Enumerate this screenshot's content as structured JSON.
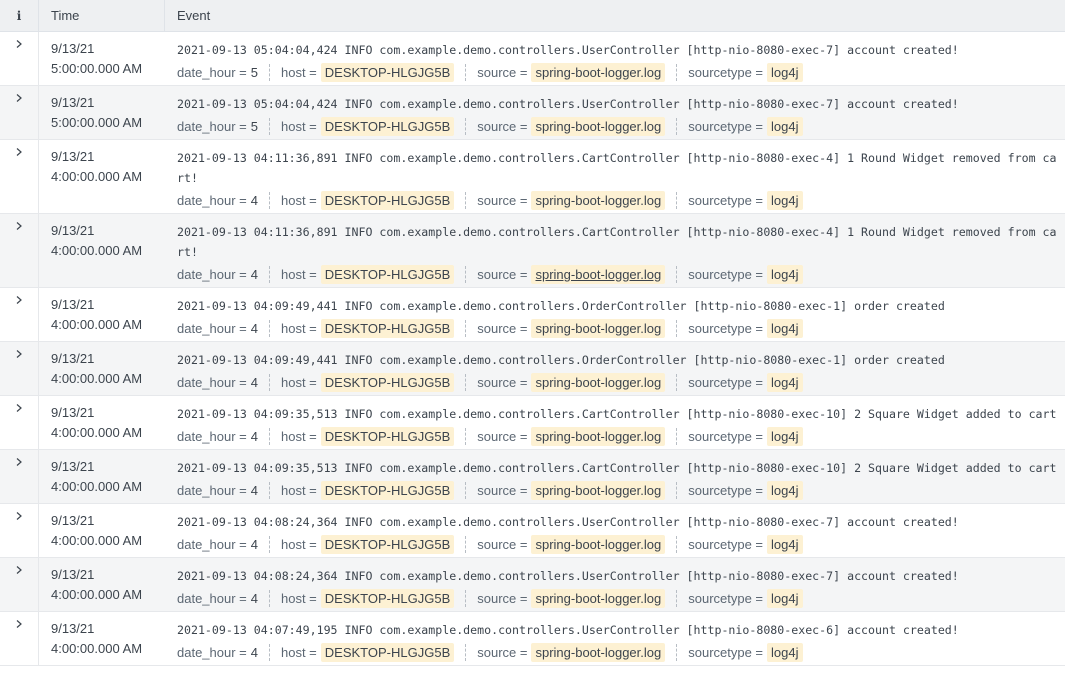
{
  "header": {
    "info_label": "i",
    "time_label": "Time",
    "event_label": "Event"
  },
  "field_keys": {
    "date_hour": "date_hour =",
    "host": "host =",
    "source": "source =",
    "sourcetype": "sourcetype ="
  },
  "rows": [
    {
      "date": "9/13/21",
      "time": "5:00:00.000 AM",
      "raw": "2021-09-13 05:04:04,424 INFO com.example.demo.controllers.UserController [http-nio-8080-exec-7] account created!",
      "date_hour": "5",
      "host": "DESKTOP-HLGJG5B",
      "source": "spring-boot-logger.log",
      "sourcetype": "log4j"
    },
    {
      "date": "9/13/21",
      "time": "5:00:00.000 AM",
      "raw": "2021-09-13 05:04:04,424 INFO com.example.demo.controllers.UserController [http-nio-8080-exec-7] account created!",
      "date_hour": "5",
      "host": "DESKTOP-HLGJG5B",
      "source": "spring-boot-logger.log",
      "sourcetype": "log4j"
    },
    {
      "date": "9/13/21",
      "time": "4:00:00.000 AM",
      "raw": "2021-09-13 04:11:36,891 INFO com.example.demo.controllers.CartController [http-nio-8080-exec-4] 1 Round Widget removed from cart!",
      "date_hour": "4",
      "host": "DESKTOP-HLGJG5B",
      "source": "spring-boot-logger.log",
      "sourcetype": "log4j"
    },
    {
      "date": "9/13/21",
      "time": "4:00:00.000 AM",
      "raw": "2021-09-13 04:11:36,891 INFO com.example.demo.controllers.CartController [http-nio-8080-exec-4] 1 Round Widget removed from cart!",
      "date_hour": "4",
      "host": "DESKTOP-HLGJG5B",
      "source": "spring-boot-logger.log",
      "sourcetype": "log4j"
    },
    {
      "date": "9/13/21",
      "time": "4:00:00.000 AM",
      "raw": "2021-09-13 04:09:49,441 INFO com.example.demo.controllers.OrderController [http-nio-8080-exec-1] order created",
      "date_hour": "4",
      "host": "DESKTOP-HLGJG5B",
      "source": "spring-boot-logger.log",
      "sourcetype": "log4j"
    },
    {
      "date": "9/13/21",
      "time": "4:00:00.000 AM",
      "raw": "2021-09-13 04:09:49,441 INFO com.example.demo.controllers.OrderController [http-nio-8080-exec-1] order created",
      "date_hour": "4",
      "host": "DESKTOP-HLGJG5B",
      "source": "spring-boot-logger.log",
      "sourcetype": "log4j"
    },
    {
      "date": "9/13/21",
      "time": "4:00:00.000 AM",
      "raw": "2021-09-13 04:09:35,513 INFO com.example.demo.controllers.CartController [http-nio-8080-exec-10] 2 Square Widget added to cart",
      "date_hour": "4",
      "host": "DESKTOP-HLGJG5B",
      "source": "spring-boot-logger.log",
      "sourcetype": "log4j"
    },
    {
      "date": "9/13/21",
      "time": "4:00:00.000 AM",
      "raw": "2021-09-13 04:09:35,513 INFO com.example.demo.controllers.CartController [http-nio-8080-exec-10] 2 Square Widget added to cart",
      "date_hour": "4",
      "host": "DESKTOP-HLGJG5B",
      "source": "spring-boot-logger.log",
      "sourcetype": "log4j"
    },
    {
      "date": "9/13/21",
      "time": "4:00:00.000 AM",
      "raw": "2021-09-13 04:08:24,364 INFO com.example.demo.controllers.UserController [http-nio-8080-exec-7] account created!",
      "date_hour": "4",
      "host": "DESKTOP-HLGJG5B",
      "source": "spring-boot-logger.log",
      "sourcetype": "log4j"
    },
    {
      "date": "9/13/21",
      "time": "4:00:00.000 AM",
      "raw": "2021-09-13 04:08:24,364 INFO com.example.demo.controllers.UserController [http-nio-8080-exec-7] account created!",
      "date_hour": "4",
      "host": "DESKTOP-HLGJG5B",
      "source": "spring-boot-logger.log",
      "sourcetype": "log4j"
    },
    {
      "date": "9/13/21",
      "time": "4:00:00.000 AM",
      "raw": "2021-09-13 04:07:49,195 INFO com.example.demo.controllers.UserController [http-nio-8080-exec-6] account created!",
      "date_hour": "4",
      "host": "DESKTOP-HLGJG5B",
      "source": "spring-boot-logger.log",
      "sourcetype": "log4j"
    }
  ]
}
